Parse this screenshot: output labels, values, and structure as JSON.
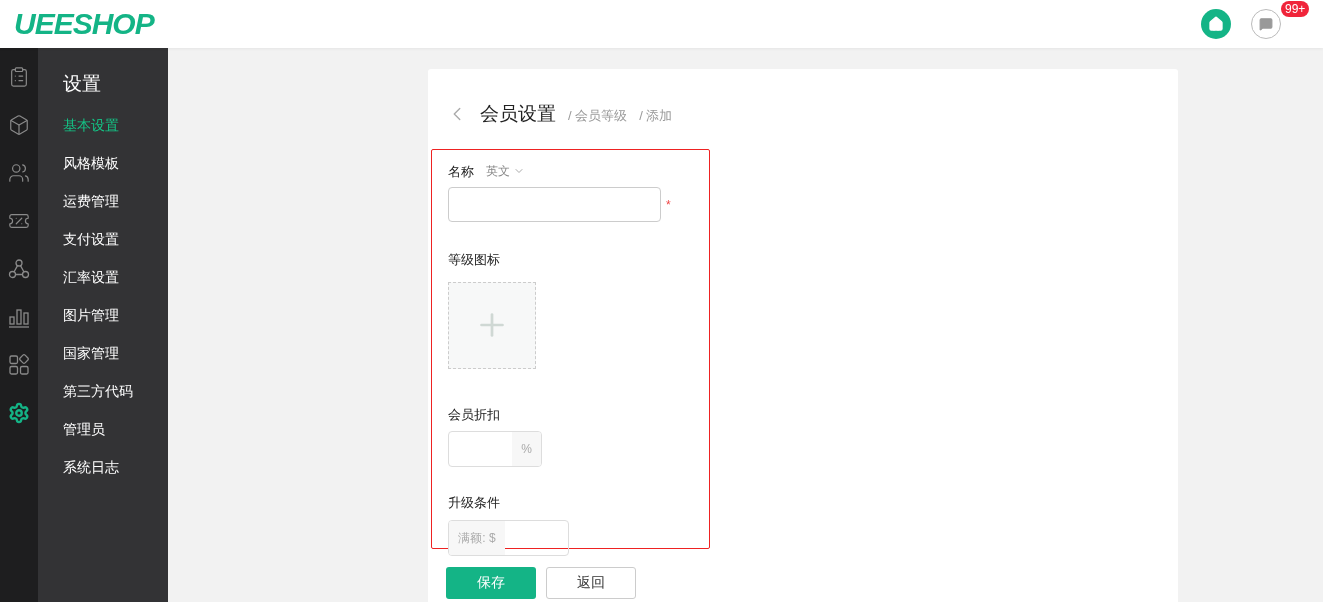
{
  "header": {
    "logo": "UEESHOP",
    "notification_badge": "99+"
  },
  "rail": [
    {
      "kind": "clipboard",
      "selected": false
    },
    {
      "kind": "box",
      "selected": false
    },
    {
      "kind": "users",
      "selected": false
    },
    {
      "kind": "coupon",
      "selected": false
    },
    {
      "kind": "share",
      "selected": false
    },
    {
      "kind": "chart",
      "selected": false
    },
    {
      "kind": "apps",
      "selected": false
    },
    {
      "kind": "settings",
      "selected": true
    }
  ],
  "sidebar": {
    "title": "设置",
    "items": [
      {
        "label": "基本设置",
        "selected": true
      },
      {
        "label": "风格模板",
        "selected": false
      },
      {
        "label": "运费管理",
        "selected": false
      },
      {
        "label": "支付设置",
        "selected": false
      },
      {
        "label": "汇率设置",
        "selected": false
      },
      {
        "label": "图片管理",
        "selected": false
      },
      {
        "label": "国家管理",
        "selected": false
      },
      {
        "label": "第三方代码",
        "selected": false
      },
      {
        "label": "管理员",
        "selected": false
      },
      {
        "label": "系统日志",
        "selected": false
      }
    ]
  },
  "page": {
    "title": "会员设置",
    "breadcrumbs": [
      "/ 会员等级",
      "/ 添加"
    ]
  },
  "form": {
    "name_label": "名称",
    "language": "英文",
    "required_mark": "*",
    "icon_label": "等级图标",
    "discount_label": "会员折扣",
    "discount_suffix": "%",
    "upgrade_label": "升级条件",
    "upgrade_prefix": "满额: $"
  },
  "buttons": {
    "save": "保存",
    "back": "返回"
  }
}
